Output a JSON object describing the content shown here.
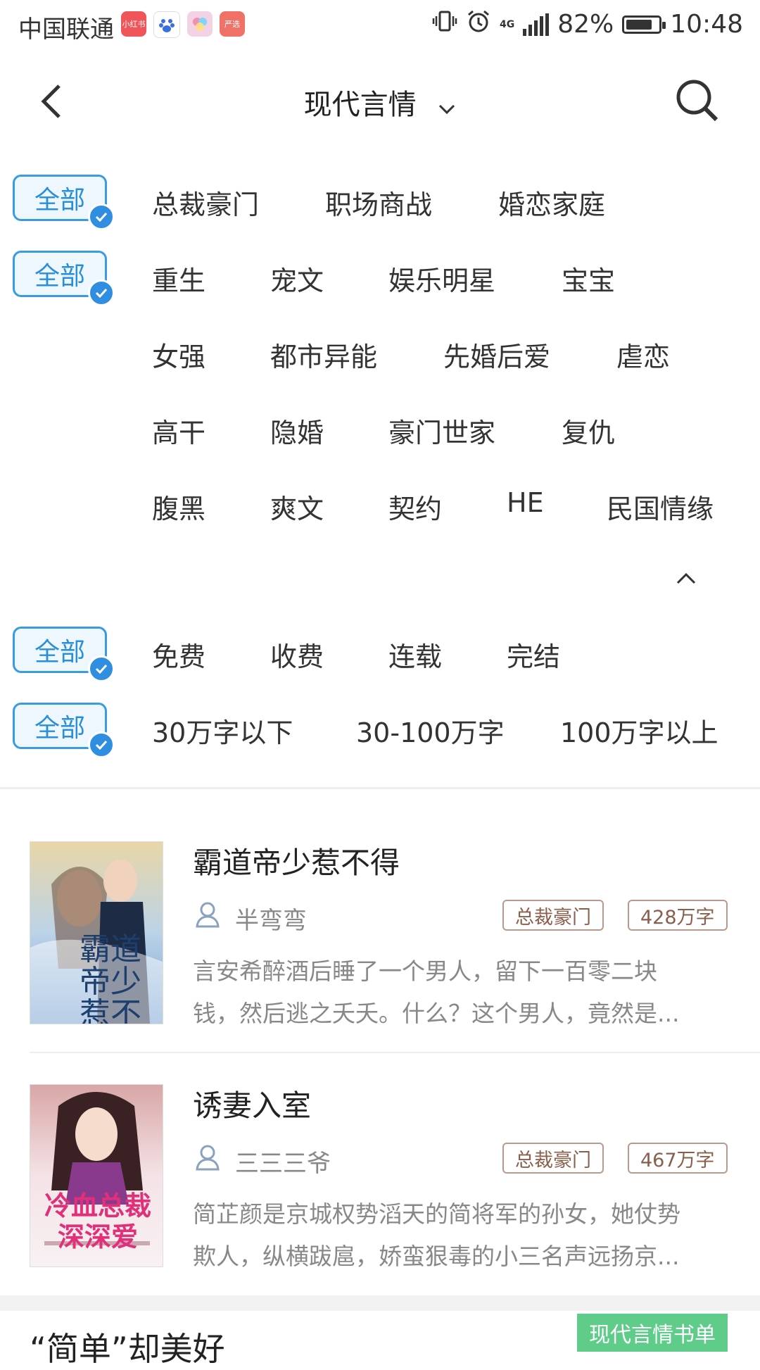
{
  "status_bar": {
    "carrier": "中国联通",
    "apps": [
      {
        "label": "小红书",
        "color": "#f0555a"
      },
      {
        "label": "",
        "color": "#ffffff"
      },
      {
        "label": "",
        "color": "#f4d2e6"
      },
      {
        "label": "严选",
        "color": "#ef7168"
      }
    ],
    "network": "4G",
    "battery_percent": "82%",
    "battery_level": 0.82,
    "time": "10:48"
  },
  "header": {
    "title": "现代言情",
    "back_icon": "chevron-left-icon",
    "search_icon": "search-icon"
  },
  "filters": {
    "all_label": "全部",
    "rows": [
      {
        "options": [
          "总裁豪门",
          "职场商战",
          "婚恋家庭"
        ]
      },
      {
        "options": [
          "重生",
          "宠文",
          "娱乐明星",
          "宝宝",
          "女强",
          "都市异能",
          "先婚后爱",
          "虐恋",
          "高干",
          "隐婚",
          "豪门世家",
          "复仇",
          "腹黑",
          "爽文",
          "契约",
          "HE",
          "民国情缘"
        ]
      },
      {
        "options": [
          "免费",
          "收费",
          "连载",
          "完结"
        ]
      },
      {
        "options": [
          "30万字以下",
          "30-100万字",
          "100万字以上"
        ]
      }
    ]
  },
  "books": [
    {
      "title": "霸道帝少惹不得",
      "author": "半弯弯",
      "category": "总裁豪门",
      "words": "428万字",
      "desc_line1": "言安希醉酒后睡了一个男人，留下一百零二块",
      "desc_line2": "钱，然后逃之夭夭。什么？这个男人，竟然是...",
      "cover_text": "霸道帝少惹不得"
    },
    {
      "title": "诱妻入室",
      "author": "三三三爷",
      "category": "总裁豪门",
      "words": "467万字",
      "desc_line1": "简芷颜是京城权势滔天的简将军的孙女，她仗势",
      "desc_line2": "欺人，纵横跋扈，娇蛮狠毒的小三名声远扬京...",
      "cover_text": "冷血总裁深深爱"
    }
  ],
  "next_section_title": "“简单”却美好",
  "float_button": "现代言情书单",
  "colors": {
    "accent_blue": "#2a8fd8",
    "tag_brown": "#8b5e4b",
    "float_green": "#5fcc8a"
  }
}
